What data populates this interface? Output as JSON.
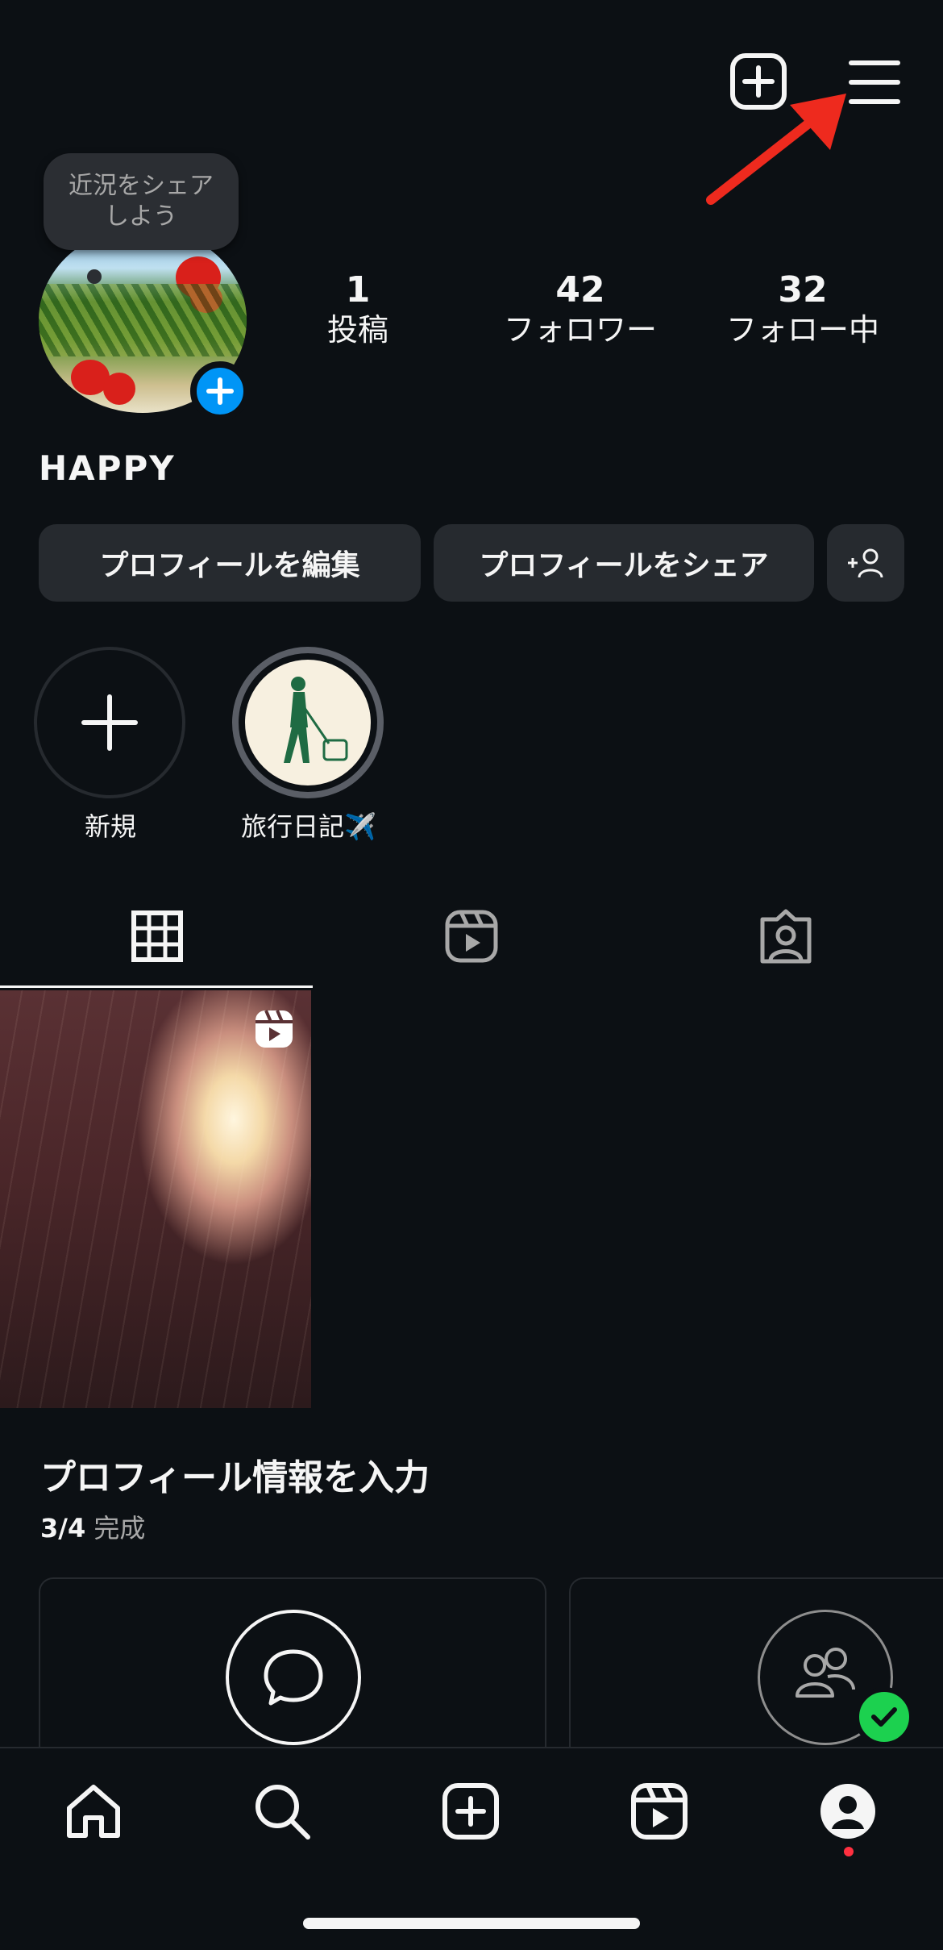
{
  "note": {
    "text": "近況をシェア\nしよう"
  },
  "stats": [
    {
      "value": "1",
      "label": "投稿"
    },
    {
      "value": "42",
      "label": "フォロワー"
    },
    {
      "value": "32",
      "label": "フォロー中"
    }
  ],
  "profile": {
    "username": "HAPPY"
  },
  "buttons": {
    "edit_profile": "プロフィールを編集",
    "share_profile": "プロフィールをシェア"
  },
  "highlights": [
    {
      "label": "新規"
    },
    {
      "label": "旅行日記✈️"
    }
  ],
  "profile_completion": {
    "title": "プロフィール情報を入力",
    "progress": "3/4",
    "status": "完成"
  },
  "icons": {
    "top": [
      "plus-square-icon",
      "hamburger-menu-icon"
    ],
    "tabs": [
      "grid-icon",
      "reels-icon",
      "tagged-icon"
    ],
    "nav": [
      "home-icon",
      "search-icon",
      "create-icon",
      "reels-icon",
      "profile-icon"
    ]
  },
  "colors": {
    "background": "#0c1014",
    "accent": "#0095f6",
    "annotation_arrow": "#ee2a1e",
    "check": "#1cd14f",
    "notification_dot": "#ff3040"
  }
}
